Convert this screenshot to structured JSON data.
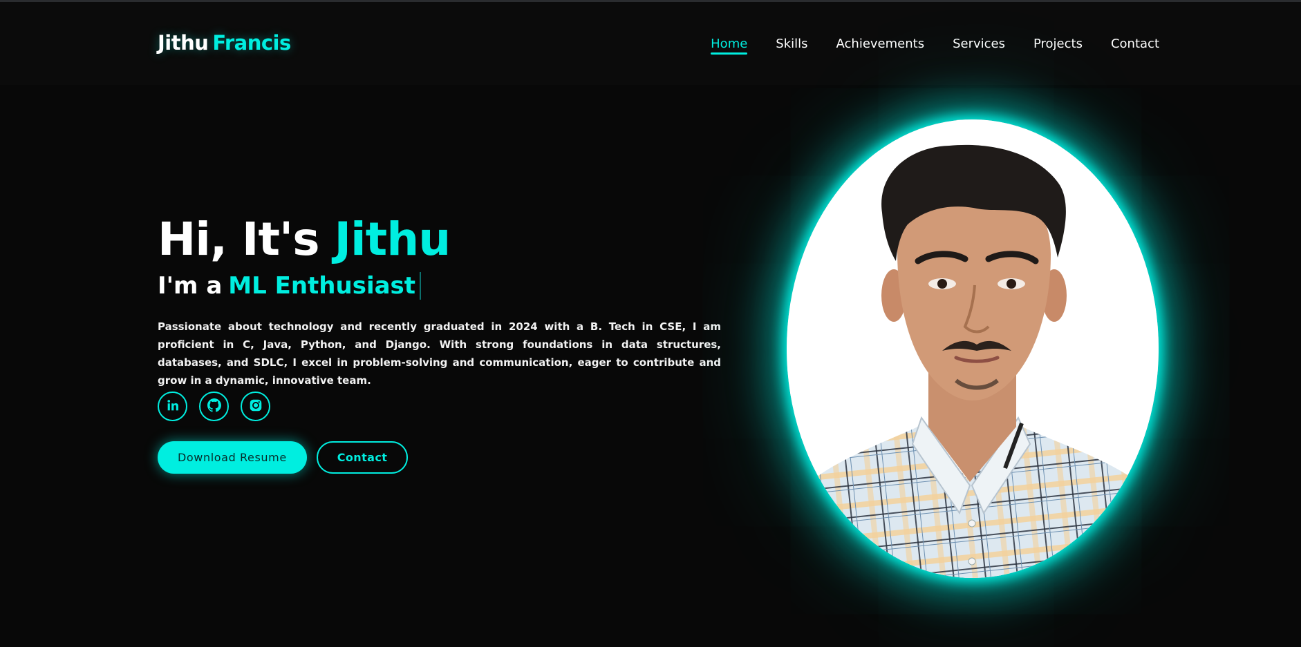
{
  "logo": {
    "first": "Jithu",
    "last": "Francis"
  },
  "nav": {
    "items": [
      {
        "label": "Home",
        "active": true
      },
      {
        "label": "Skills",
        "active": false
      },
      {
        "label": "Achievements",
        "active": false
      },
      {
        "label": "Services",
        "active": false
      },
      {
        "label": "Projects",
        "active": false
      },
      {
        "label": "Contact",
        "active": false
      }
    ]
  },
  "hero": {
    "greeting": "Hi, It's",
    "name": "Jithu",
    "role_prefix": "I'm a",
    "role": "ML Enthusiast",
    "description": "Passionate about technology and recently graduated in 2024 with a B. Tech in CSE, I am proficient in C, Java, Python, and Django. With strong foundations in data structures, databases, and SDLC, I excel in problem-solving and communication, eager to contribute and grow in a dynamic, innovative team."
  },
  "socials": [
    {
      "icon": "linkedin-icon"
    },
    {
      "icon": "github-icon"
    },
    {
      "icon": "instagram-icon"
    }
  ],
  "buttons": {
    "download_resume": "Download Resume",
    "contact": "Contact"
  },
  "colors": {
    "accent": "#00eee0",
    "background": "#080808",
    "header": "#0b0b0b"
  }
}
